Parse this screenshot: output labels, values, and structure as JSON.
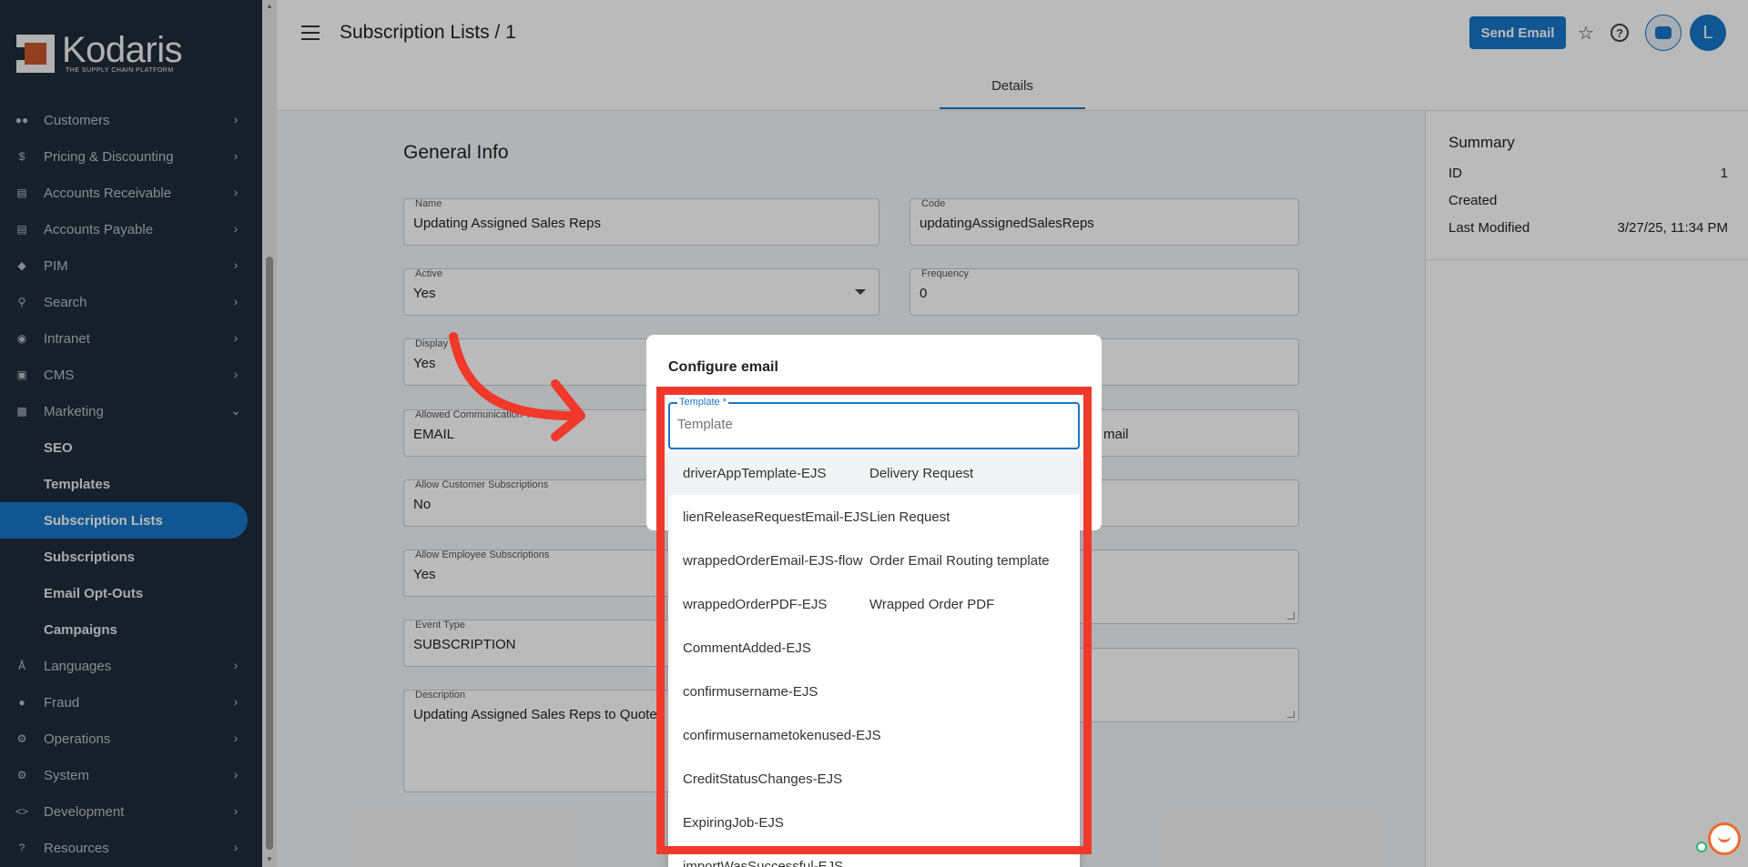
{
  "app": {
    "brand": "Kodaris",
    "tagline": "THE SUPPLY CHAIN PLATFORM"
  },
  "sidebar": {
    "items": [
      {
        "label": "Customers",
        "icon": "people-icon"
      },
      {
        "label": "Pricing & Discounting",
        "icon": "dollar-icon"
      },
      {
        "label": "Accounts Receivable",
        "icon": "bank-icon"
      },
      {
        "label": "Accounts Payable",
        "icon": "bank-icon"
      },
      {
        "label": "PIM",
        "icon": "tag-icon"
      },
      {
        "label": "Search",
        "icon": "search-icon"
      },
      {
        "label": "Intranet",
        "icon": "globe-icon"
      },
      {
        "label": "CMS",
        "icon": "layout-icon"
      },
      {
        "label": "Marketing",
        "icon": "megaphone-icon"
      }
    ],
    "marketing_sub": [
      {
        "label": "SEO"
      },
      {
        "label": "Templates"
      },
      {
        "label": "Subscription Lists"
      },
      {
        "label": "Subscriptions"
      },
      {
        "label": "Email Opt-Outs"
      },
      {
        "label": "Campaigns"
      }
    ],
    "items_after": [
      {
        "label": "Languages",
        "icon": "translate-icon"
      },
      {
        "label": "Fraud",
        "icon": "alert-icon"
      },
      {
        "label": "Operations",
        "icon": "gear-globe-icon"
      },
      {
        "label": "System",
        "icon": "gear-icon"
      },
      {
        "label": "Development",
        "icon": "code-icon"
      },
      {
        "label": "Resources",
        "icon": "help-icon"
      }
    ]
  },
  "header": {
    "title": "Subscription Lists / 1",
    "send_email": "Send Email",
    "avatar_initial": "L",
    "tab": "Details"
  },
  "general": {
    "title": "General Info",
    "name": {
      "label": "Name",
      "value": "Updating Assigned Sales Reps"
    },
    "code": {
      "label": "Code",
      "value": "updatingAssignedSalesReps"
    },
    "active": {
      "label": "Active",
      "value": "Yes"
    },
    "frequency": {
      "label": "Frequency",
      "value": "0"
    },
    "display": {
      "label": "Display",
      "value": "Yes"
    },
    "allowed_comm": {
      "label": "Allowed Communication T",
      "value": "EMAIL"
    },
    "right_email_fragment": "mail",
    "allow_customer": {
      "label": "Allow Customer Subscriptions",
      "value": "No"
    },
    "allow_employee": {
      "label": "Allow Employee Subscriptions",
      "value": "Yes"
    },
    "event_type": {
      "label": "Event Type",
      "value": "SUBSCRIPTION"
    },
    "description": {
      "label": "Description",
      "value": "Updating Assigned Sales Reps to Quotes in"
    }
  },
  "summary": {
    "title": "Summary",
    "rows": [
      {
        "label": "ID",
        "value": "1"
      },
      {
        "label": "Created",
        "value": ""
      },
      {
        "label": "Last Modified",
        "value": "3/27/25, 11:34 PM"
      }
    ]
  },
  "dialog": {
    "title": "Configure email",
    "template_label": "Template *",
    "template_placeholder": "Template",
    "options": [
      {
        "code": "driverAppTemplate-EJS",
        "name": "Delivery Request"
      },
      {
        "code": "lienReleaseRequestEmail-EJS",
        "name": "Lien Request"
      },
      {
        "code": "wrappedOrderEmail-EJS-flow",
        "name": "Order Email Routing template"
      },
      {
        "code": "wrappedOrderPDF-EJS",
        "name": "Wrapped Order PDF"
      },
      {
        "code": "CommentAdded-EJS",
        "name": ""
      },
      {
        "code": "confirmusername-EJS",
        "name": ""
      },
      {
        "code": "confirmusernametokenused-EJS",
        "name": ""
      },
      {
        "code": "CreditStatusChanges-EJS",
        "name": ""
      },
      {
        "code": "ExpiringJob-EJS",
        "name": ""
      },
      {
        "code": "importWasSuccessful-EJS",
        "name": ""
      }
    ]
  },
  "colors": {
    "accent": "#1776c8",
    "sidebar": "#1f2b3a",
    "highlight": "#f0382b"
  }
}
